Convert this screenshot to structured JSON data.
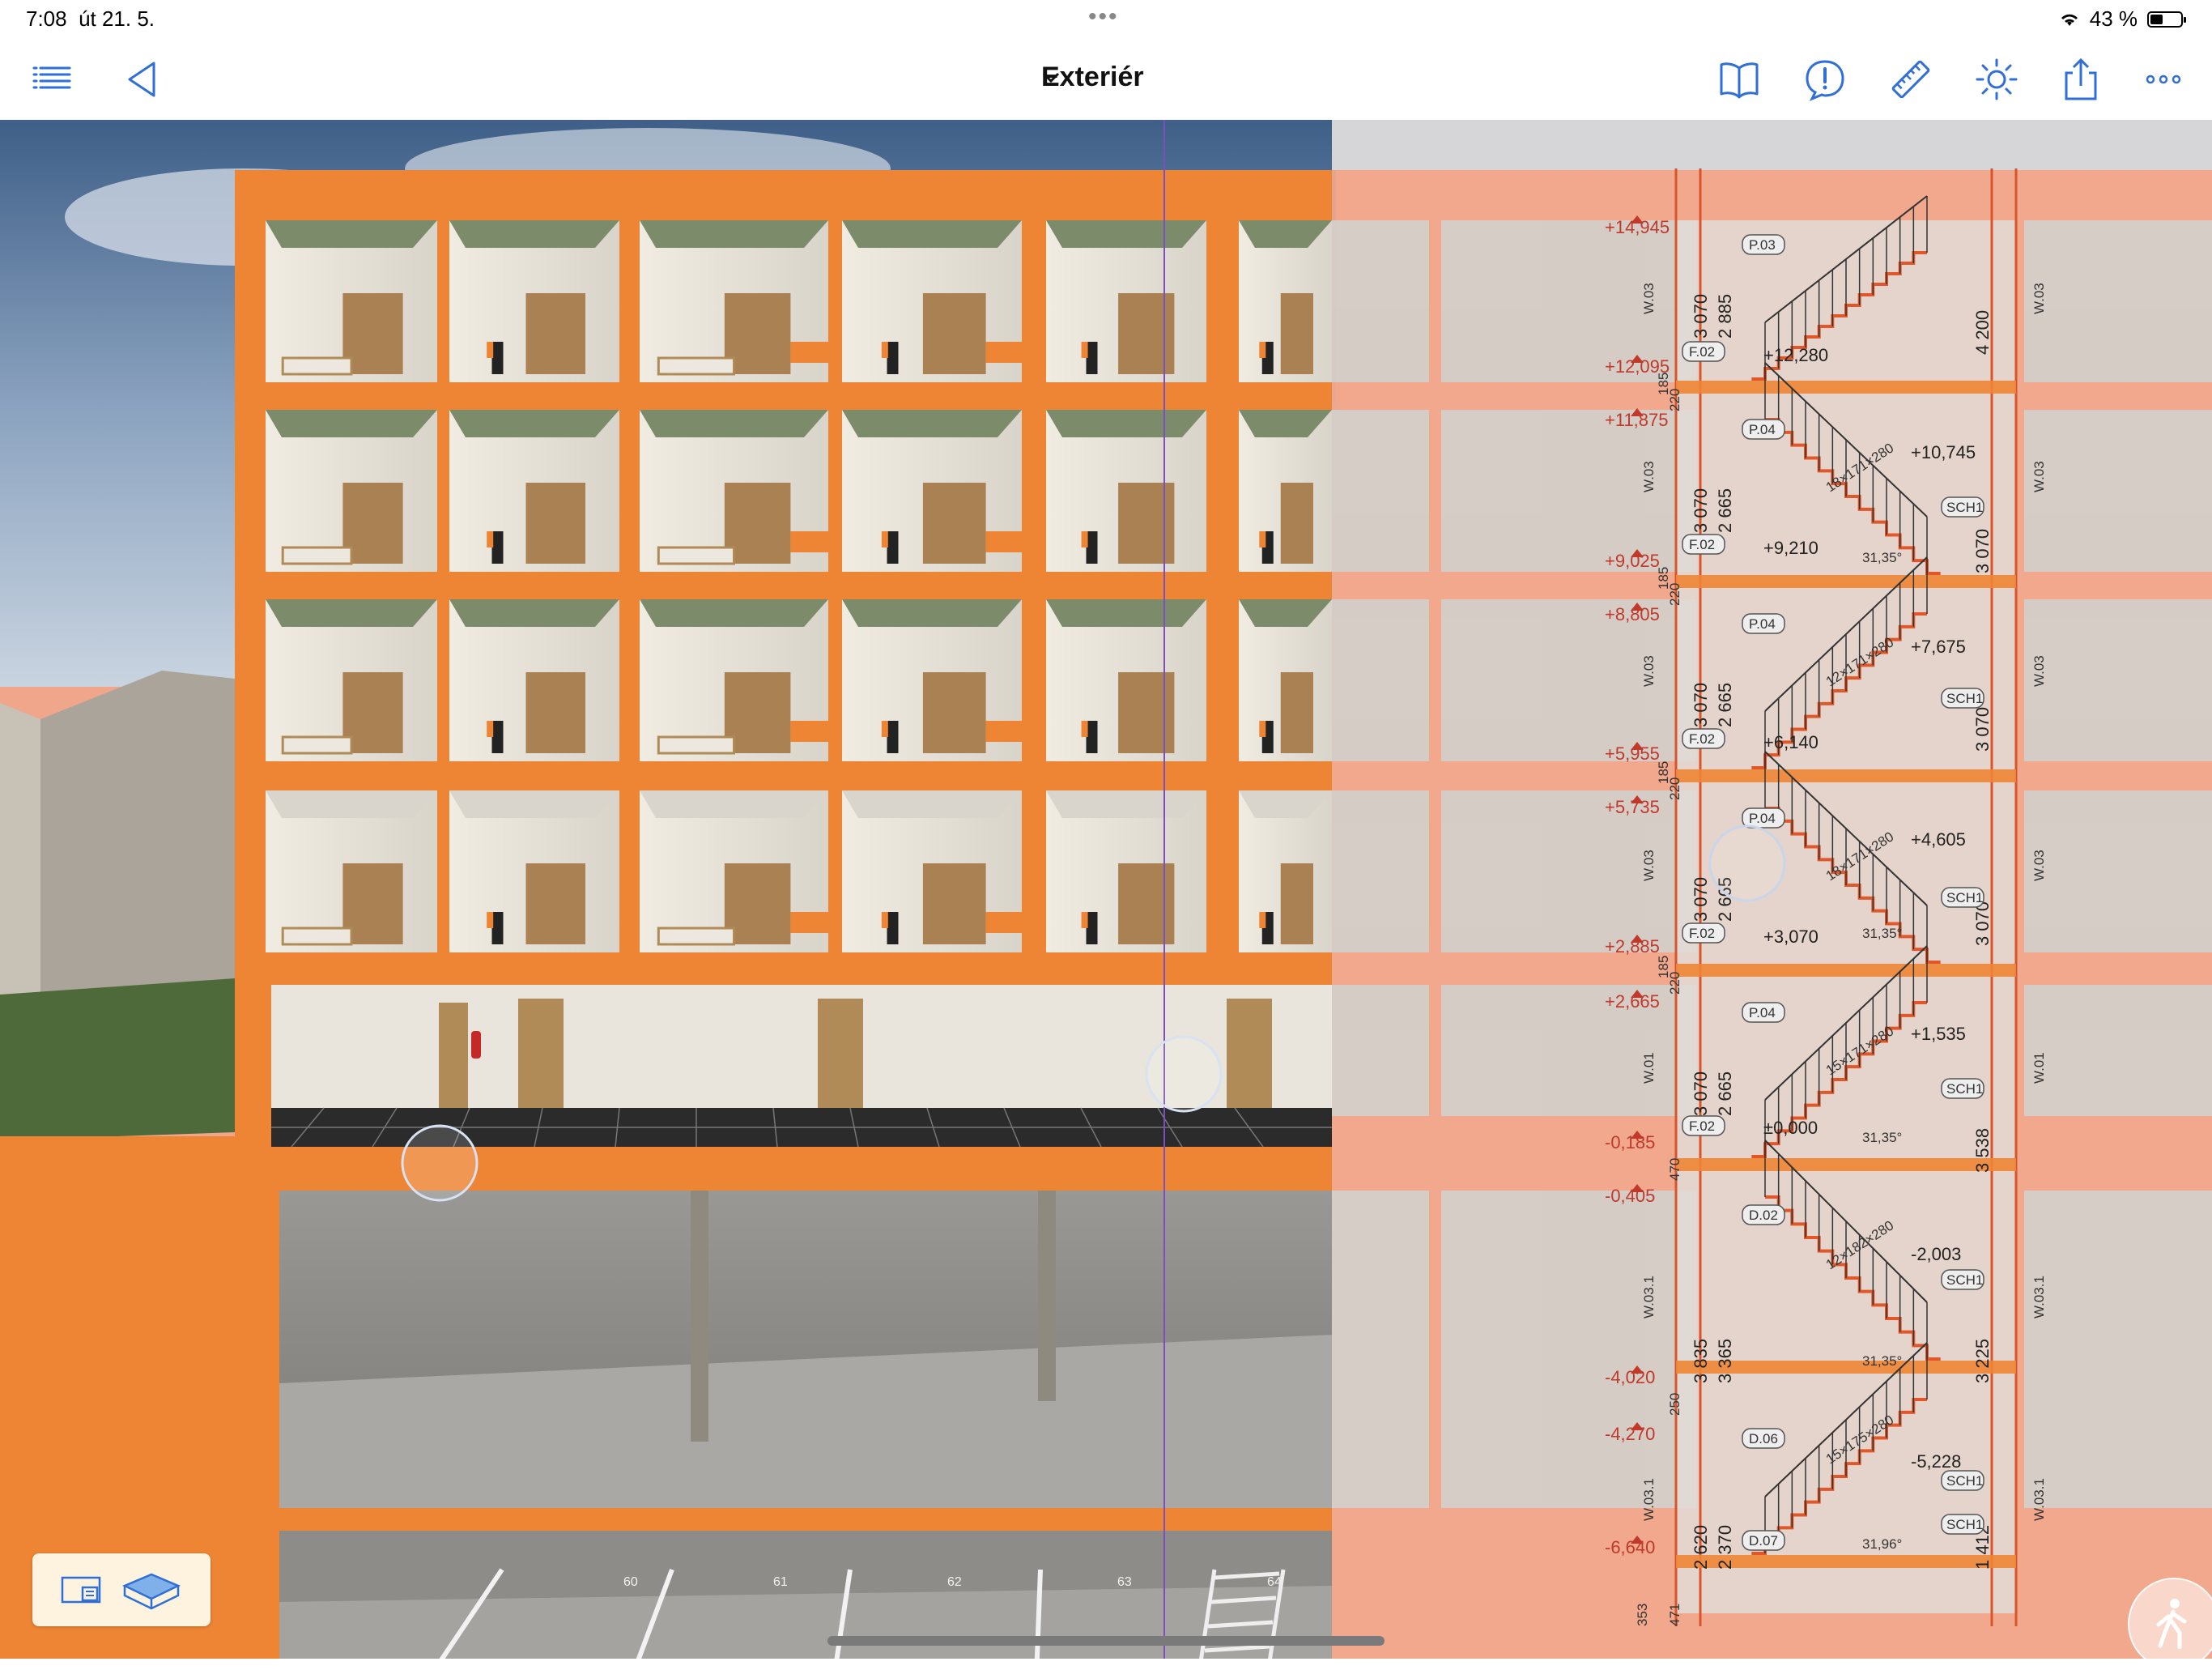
{
  "status_bar": {
    "time": "7:08",
    "date": "út 21. 5.",
    "battery": "43 %",
    "battery_level": 0.43
  },
  "nav": {
    "title": "Exteriér",
    "icons": [
      "list-icon",
      "back-triangle-icon",
      "book-icon",
      "alert-bubble-icon",
      "ruler-icon",
      "sun-icon",
      "share-icon",
      "more-icon"
    ]
  },
  "section": {
    "levels": [
      {
        "label": "+14,945"
      },
      {
        "label": "+12,095"
      },
      {
        "label": "+11,875"
      },
      {
        "label": "+9,025"
      },
      {
        "label": "+8,805"
      },
      {
        "label": "+5,955"
      },
      {
        "label": "+5,735"
      },
      {
        "label": "+2,885"
      },
      {
        "label": "+2,665"
      },
      {
        "label": "-0,185"
      },
      {
        "label": "-0,405"
      },
      {
        "label": "-4,020"
      },
      {
        "label": "-4,270"
      },
      {
        "label": "-6,640"
      }
    ],
    "landings": [
      "+12,280",
      "+10,745",
      "+9,210",
      "+7,675",
      "+6,140",
      "+4,605",
      "+3,070",
      "+1,535",
      "±0,000",
      "-2,003",
      "-5,228"
    ],
    "dims_a": [
      "3 070",
      "3 070",
      "3 070",
      "3 070",
      "3 070",
      "3 835",
      "2 620"
    ],
    "dims_b": [
      "2 885",
      "2 665",
      "2 665",
      "2 665",
      "2 665",
      "3 365",
      "2 370"
    ],
    "dims_right": [
      "4 200",
      "3 070",
      "3 070",
      "3 070",
      "3 538",
      "3 225",
      "1 412"
    ],
    "door_tags": [
      "P.03",
      "P.04",
      "P.04",
      "P.04",
      "P.04",
      "D.02",
      "D.06",
      "D.07"
    ],
    "floor_tags": [
      "F.02",
      "F.02",
      "F.02",
      "F.02",
      "F.02"
    ],
    "wall_tags": [
      "W.03",
      "W.03",
      "W.03",
      "W.03",
      "W.01",
      "W.03.1",
      "W.03.1"
    ],
    "right_wall_tags": [
      "W.03",
      "W.03",
      "W.03",
      "W.03",
      "W.01",
      "W.03.1",
      "W.03.1"
    ],
    "stair_tags": [
      "SCH1",
      "SCH1",
      "SCH1",
      "SCH1",
      "SCH1",
      "SCH1",
      "SCH1"
    ],
    "stair_notes": [
      "18×171×280",
      "12×171×280",
      "18×171×280",
      "15×171×280",
      "12×182×280",
      "15×175×280"
    ],
    "angles": [
      "31,35°",
      "31,35°",
      "31,35°",
      "31,35°",
      "31,96°"
    ],
    "small_dims": [
      "220",
      "185",
      "220",
      "185",
      "220",
      "185",
      "220",
      "185",
      "470",
      "250",
      "353",
      "471"
    ],
    "parking_numbers": [
      "60",
      "61",
      "62",
      "63",
      "64"
    ]
  }
}
